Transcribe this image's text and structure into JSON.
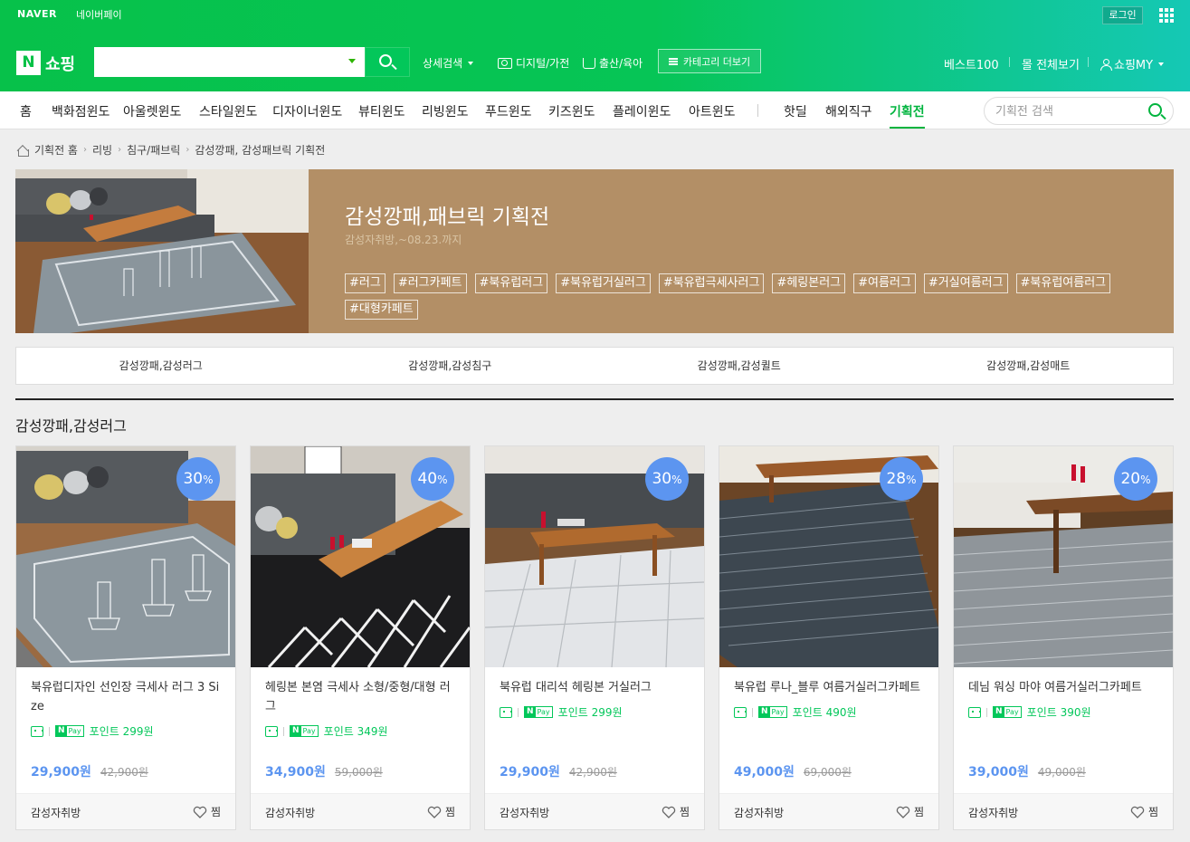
{
  "header": {
    "naver_logo": "NAVER",
    "naverpay_label": "네이버페이",
    "login_label": "로그인",
    "shopping_logo_n": "N",
    "shopping_logo_text": "쇼핑",
    "search_value": "",
    "detail_search": "상세검색",
    "quick_links": [
      "디지털/가전",
      "출산/육아"
    ],
    "category_more": "카테고리 더보기",
    "best100": "베스트100",
    "all_malls": "몰 전체보기",
    "my_shopping": "쇼핑MY"
  },
  "nav": {
    "items": [
      "홈",
      "백화점윈도",
      "아울렛윈도",
      "스타일윈도",
      "디자이너윈도",
      "뷰티윈도",
      "리빙윈도",
      "푸드윈도",
      "키즈윈도",
      "플레이윈도",
      "아트윈도"
    ],
    "items2": [
      "핫딜",
      "해외직구",
      "기획전"
    ],
    "active": "기획전",
    "search_placeholder": "기획전 검색"
  },
  "breadcrumb": [
    "기획전 홈",
    "리빙",
    "침구/패브릭",
    "감성깡패, 감성패브릭 기획전"
  ],
  "banner": {
    "title": "감성깡패,패브릭 기획전",
    "subtitle": "감성자취방,~08.23.까지",
    "background_color": "#b38f66",
    "tags": [
      "#러그",
      "#러그카페트",
      "#북유럽러그",
      "#북유럽거실러그",
      "#북유럽극세사러그",
      "#헤링본러그",
      "#여름러그",
      "#거실여름러그",
      "#북유럽여름러그",
      "#대형카페트"
    ]
  },
  "subtabs": [
    "감성깡패,감성러그",
    "감성깡패,감성침구",
    "감성깡패,감성퀼트",
    "감성깡패,감성매트"
  ],
  "section_title": "감성깡패,감성러그",
  "npay": {
    "n": "N",
    "pay": "Pay"
  },
  "products": [
    {
      "discount": "30",
      "name": "북유럽디자인 선인장 극세사 러그 3 Size",
      "point": "포인트 299원",
      "sale_price": "29,900원",
      "orig_price": "42,900원",
      "store": "감성자취방",
      "zzim": "찜"
    },
    {
      "discount": "40",
      "name": "헤링본 본염 극세사 소형/중형/대형 러그",
      "point": "포인트 349원",
      "sale_price": "34,900원",
      "orig_price": "59,000원",
      "store": "감성자취방",
      "zzim": "찜"
    },
    {
      "discount": "30",
      "name": "북유럽 대리석 헤링본 거실러그",
      "point": "포인트 299원",
      "sale_price": "29,900원",
      "orig_price": "42,900원",
      "store": "감성자취방",
      "zzim": "찜"
    },
    {
      "discount": "28",
      "name": "북유럽 루나_블루 여름거실러그카페트",
      "point": "포인트 490원",
      "sale_price": "49,000원",
      "orig_price": "69,000원",
      "store": "감성자취방",
      "zzim": "찜"
    },
    {
      "discount": "20",
      "name": "데님 워싱 마야 여름거실러그카페트",
      "point": "포인트 390원",
      "sale_price": "39,000원",
      "orig_price": "49,000원",
      "store": "감성자취방",
      "zzim": "찜"
    }
  ],
  "percent_sign": "%",
  "colors": {
    "brand_green": "#03c75a",
    "discount_blue": "#5c95f0",
    "banner_brown": "#b38f66"
  }
}
